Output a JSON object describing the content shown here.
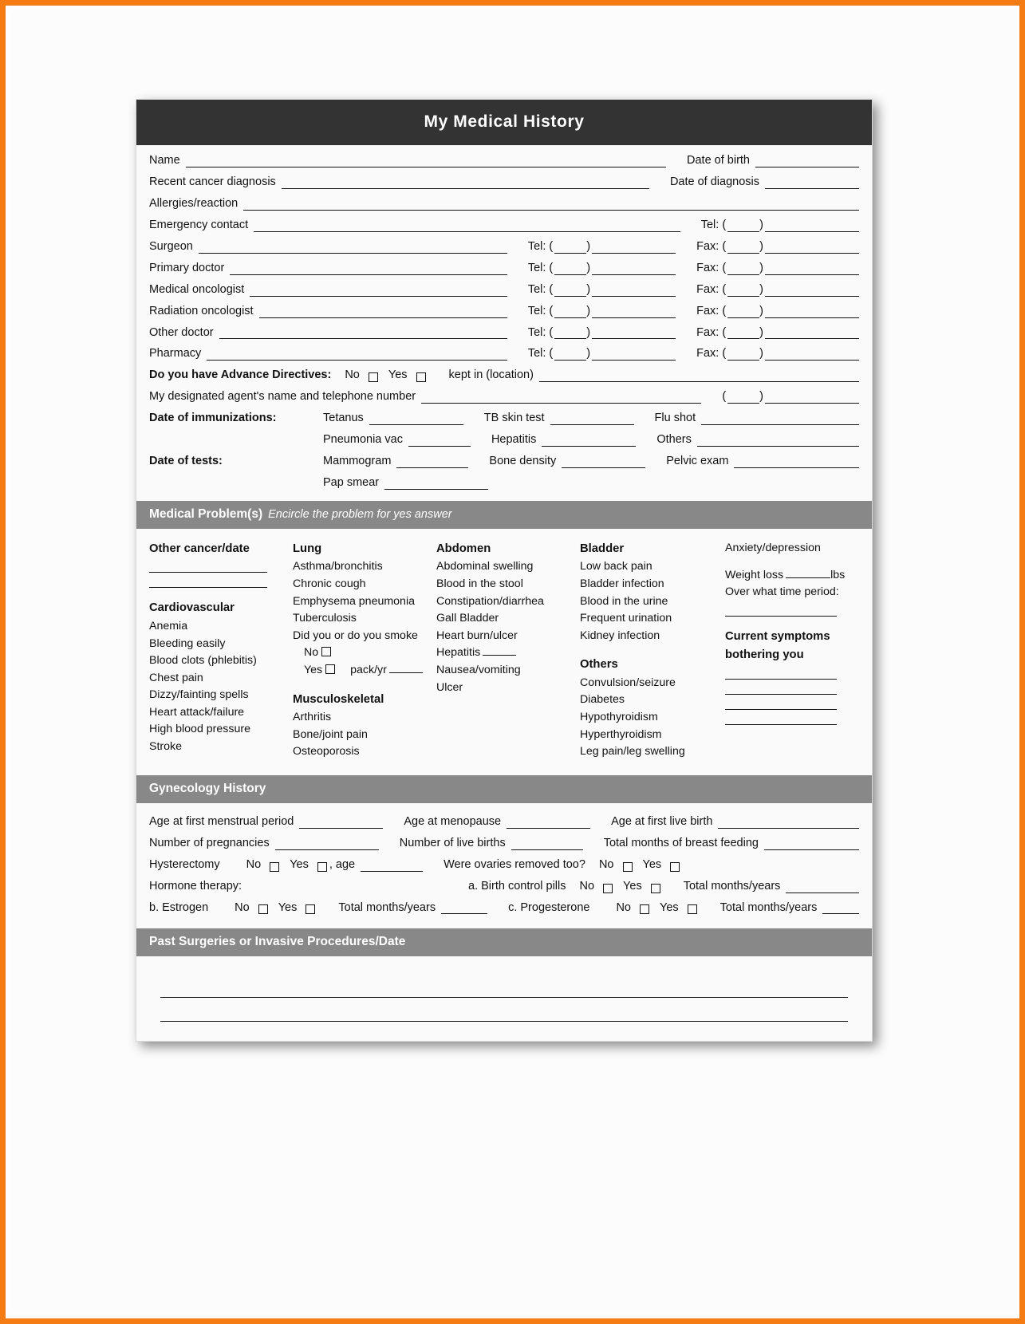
{
  "form": {
    "title": "My Medical History",
    "identity": {
      "name_label": "Name",
      "dob_label": "Date of birth",
      "cancer_dx_label": "Recent cancer diagnosis",
      "dx_date_label": "Date of diagnosis",
      "allergies_label": "Allergies/reaction",
      "emergency_label": "Emergency contact"
    },
    "tel_label": "Tel: (",
    "fax_label": "Fax: (",
    "paren_close": ")",
    "paren_open": "(",
    "contacts": [
      {
        "label": "Surgeon"
      },
      {
        "label": "Primary doctor"
      },
      {
        "label": "Medical oncologist"
      },
      {
        "label": "Radiation oncologist"
      },
      {
        "label": "Other doctor"
      },
      {
        "label": "Pharmacy"
      }
    ],
    "directives": {
      "question": "Do you have Advance Directives:",
      "no": "No",
      "yes": "Yes",
      "kept": "kept in (location)"
    },
    "agent_label": "My designated agent's name and telephone number",
    "immunizations": {
      "heading": "Date of immunizations:",
      "row1": [
        "Tetanus",
        "TB skin test",
        "Flu shot"
      ],
      "row2": [
        "Pneumonia vac",
        "Hepatitis",
        "Others"
      ]
    },
    "tests": {
      "heading": "Date of tests:",
      "row1": [
        "Mammogram",
        "Bone density",
        "Pelvic exam"
      ],
      "row2": [
        "Pap smear"
      ]
    },
    "medical_problems": {
      "band_title": "Medical Problem(s)",
      "band_hint": "Encircle the problem for yes answer",
      "columns": [
        {
          "groups": [
            {
              "heading": "Other cancer/date",
              "lines": 2,
              "items": []
            },
            {
              "heading": "Cardiovascular",
              "items": [
                "Anemia",
                "Bleeding easily",
                "Blood clots (phlebitis)",
                "Chest pain",
                "Dizzy/fainting spells",
                "Heart attack/failure",
                "High blood pressure",
                "Stroke"
              ]
            }
          ]
        },
        {
          "groups": [
            {
              "heading": "Lung",
              "items": [
                "Asthma/bronchitis",
                "Chronic cough",
                "Emphysema pneumonia",
                "Tuberculosis",
                "Did you or do you smoke"
              ]
            },
            {
              "heading": "Musculoskeletal",
              "items": [
                "Arthritis",
                "Bone/joint pain",
                "Osteoporosis"
              ]
            }
          ],
          "smoke": {
            "no": "No",
            "yes": "Yes",
            "packyr": "pack/yr"
          }
        },
        {
          "groups": [
            {
              "heading": "Abdomen",
              "items": [
                "Abdominal swelling",
                "Blood in the stool",
                "Constipation/diarrhea",
                "Gall Bladder",
                "Heart burn/ulcer",
                "Hepatitis",
                "Nausea/vomiting",
                "Ulcer"
              ]
            }
          ]
        },
        {
          "groups": [
            {
              "heading": "Bladder",
              "items": [
                "Low back pain",
                "Bladder infection",
                "Blood in the urine",
                "Frequent urination",
                "Kidney infection"
              ]
            },
            {
              "heading": "Others",
              "items": [
                "Convulsion/seizure",
                "Diabetes",
                "Hypothyroidism",
                "Hyperthyroidism",
                "Leg pain/leg swelling"
              ]
            }
          ]
        },
        {
          "anxiety": "Anxiety/depression",
          "weight_loss": "Weight loss",
          "lbs": "lbs",
          "time_period": "Over what time period:",
          "current_symptoms": "Current symptoms",
          "bothering_you": "bothering you"
        }
      ]
    },
    "gynecology": {
      "band_title": "Gynecology History",
      "age_first_period": "Age at first menstrual period",
      "age_menopause": "Age at menopause",
      "age_first_birth": "Age at first live birth",
      "num_pregnancies": "Number of pregnancies",
      "num_live_births": "Number of live births",
      "months_breast_feeding": "Total months of breast feeding",
      "hysterectomy": "Hysterectomy",
      "no": "No",
      "yes": "Yes",
      "age_suffix": ", age",
      "ovaries": "Were ovaries removed too?",
      "hormone_therapy": "Hormone therapy:",
      "a_birth_control": "a. Birth control pills",
      "b_estrogen": "b. Estrogen",
      "c_progesterone": "c. Progesterone",
      "total_months_years": "Total months/years"
    },
    "past_surgeries": {
      "band_title": "Past Surgeries or Invasive Procedures/Date"
    }
  }
}
